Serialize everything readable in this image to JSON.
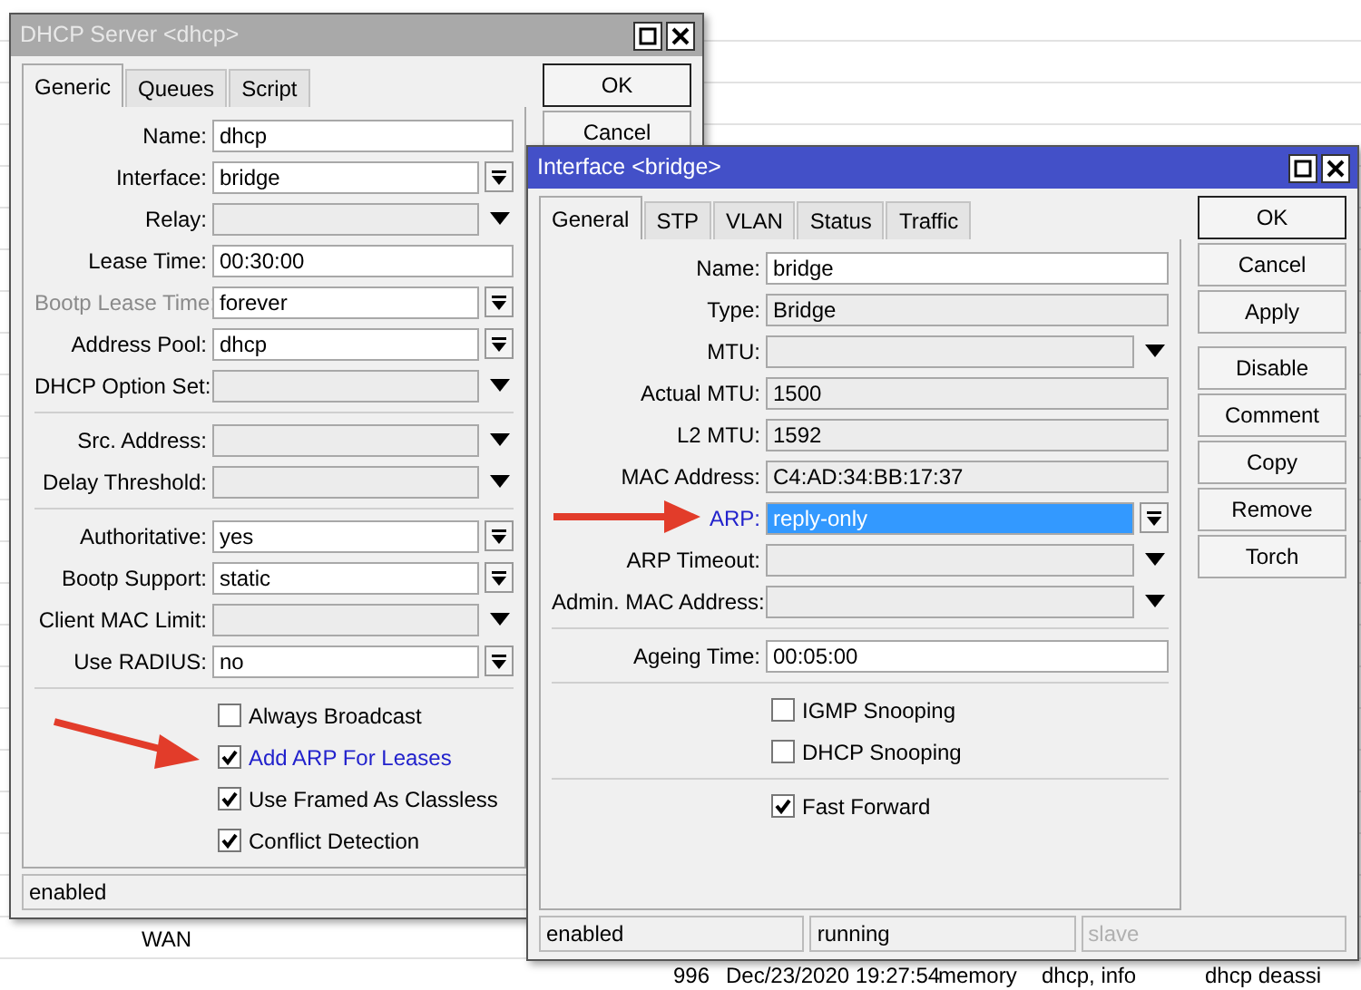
{
  "background": {
    "cells": [
      {
        "text": "WAN",
        "kind": "wan"
      },
      {
        "text": "996",
        "kind": "log"
      },
      {
        "text": "Dec/23/2020 19:27:54",
        "kind": "log"
      },
      {
        "text": "memory",
        "kind": "log"
      },
      {
        "text": "dhcp, info",
        "kind": "log"
      },
      {
        "text": "dhcp deassi",
        "kind": "log"
      }
    ]
  },
  "windows": [
    {
      "title": "DHCP Server <dhcp>",
      "active": false,
      "tabs": [
        {
          "label": "Generic",
          "selected": true
        },
        {
          "label": "Queues",
          "selected": false
        },
        {
          "label": "Script",
          "selected": false
        }
      ],
      "field_groups": [
        [
          {
            "label": "Name:",
            "kind": "text",
            "value": "dhcp"
          },
          {
            "label": "Interface:",
            "kind": "combo",
            "value": "bridge"
          },
          {
            "label": "Relay:",
            "kind": "dropdown"
          },
          {
            "label": "Lease Time:",
            "kind": "text",
            "value": "00:30:00"
          },
          {
            "label": "Bootp Lease Time:",
            "kind": "combo",
            "value": "forever",
            "label_disabled": true
          },
          {
            "label": "Address Pool:",
            "kind": "combo",
            "value": "dhcp"
          },
          {
            "label": "DHCP Option Set:",
            "kind": "dropdown"
          }
        ],
        [
          {
            "label": "Src. Address:",
            "kind": "dropdown"
          },
          {
            "label": "Delay Threshold:",
            "kind": "dropdown"
          }
        ],
        [
          {
            "label": "Authoritative:",
            "kind": "combo",
            "value": "yes"
          },
          {
            "label": "Bootp Support:",
            "kind": "combo",
            "value": "static"
          },
          {
            "label": "Client MAC Limit:",
            "kind": "dropdown"
          },
          {
            "label": "Use RADIUS:",
            "kind": "combo",
            "value": "no"
          }
        ]
      ],
      "checkbox_groups": [
        [
          {
            "label": "Always Broadcast",
            "checked": false
          },
          {
            "label": "Add ARP For Leases",
            "checked": true,
            "highlighted": true
          },
          {
            "label": "Use Framed As Classless",
            "checked": true
          },
          {
            "label": "Conflict Detection",
            "checked": true
          }
        ]
      ],
      "buttons": [
        "OK",
        "Cancel"
      ],
      "status_bar": [
        {
          "text": "enabled",
          "disabled": false
        }
      ]
    },
    {
      "title": "Interface <bridge>",
      "active": true,
      "tabs": [
        {
          "label": "General",
          "selected": true
        },
        {
          "label": "STP",
          "selected": false
        },
        {
          "label": "VLAN",
          "selected": false
        },
        {
          "label": "Status",
          "selected": false
        },
        {
          "label": "Traffic",
          "selected": false
        }
      ],
      "field_groups": [
        [
          {
            "label": "Name:",
            "kind": "text",
            "value": "bridge"
          },
          {
            "label": "Type:",
            "kind": "readonly",
            "value": "Bridge"
          },
          {
            "label": "MTU:",
            "kind": "dropdown"
          },
          {
            "label": "Actual MTU:",
            "kind": "readonly",
            "value": "1500"
          },
          {
            "label": "L2 MTU:",
            "kind": "readonly",
            "value": "1592"
          },
          {
            "label": "MAC Address:",
            "kind": "readonly",
            "value": "C4:AD:34:BB:17:37"
          },
          {
            "label": "ARP:",
            "kind": "combo",
            "value": "reply-only",
            "highlighted": true,
            "selected": true
          },
          {
            "label": "ARP Timeout:",
            "kind": "dropdown"
          },
          {
            "label": "Admin. MAC Address:",
            "kind": "dropdown"
          }
        ],
        [
          {
            "label": "Ageing Time:",
            "kind": "text",
            "value": "00:05:00"
          }
        ]
      ],
      "checkbox_groups": [
        [
          {
            "label": "IGMP Snooping",
            "checked": false
          },
          {
            "label": "DHCP Snooping",
            "checked": false
          }
        ],
        [
          {
            "label": "Fast Forward",
            "checked": true
          }
        ]
      ],
      "buttons": [
        "OK",
        "Cancel",
        "Apply",
        "Disable",
        "Comment",
        "Copy",
        "Remove",
        "Torch"
      ],
      "status_bar": [
        {
          "text": "enabled",
          "disabled": false
        },
        {
          "text": "running",
          "disabled": false
        },
        {
          "text": "slave",
          "disabled": true
        }
      ]
    }
  ]
}
